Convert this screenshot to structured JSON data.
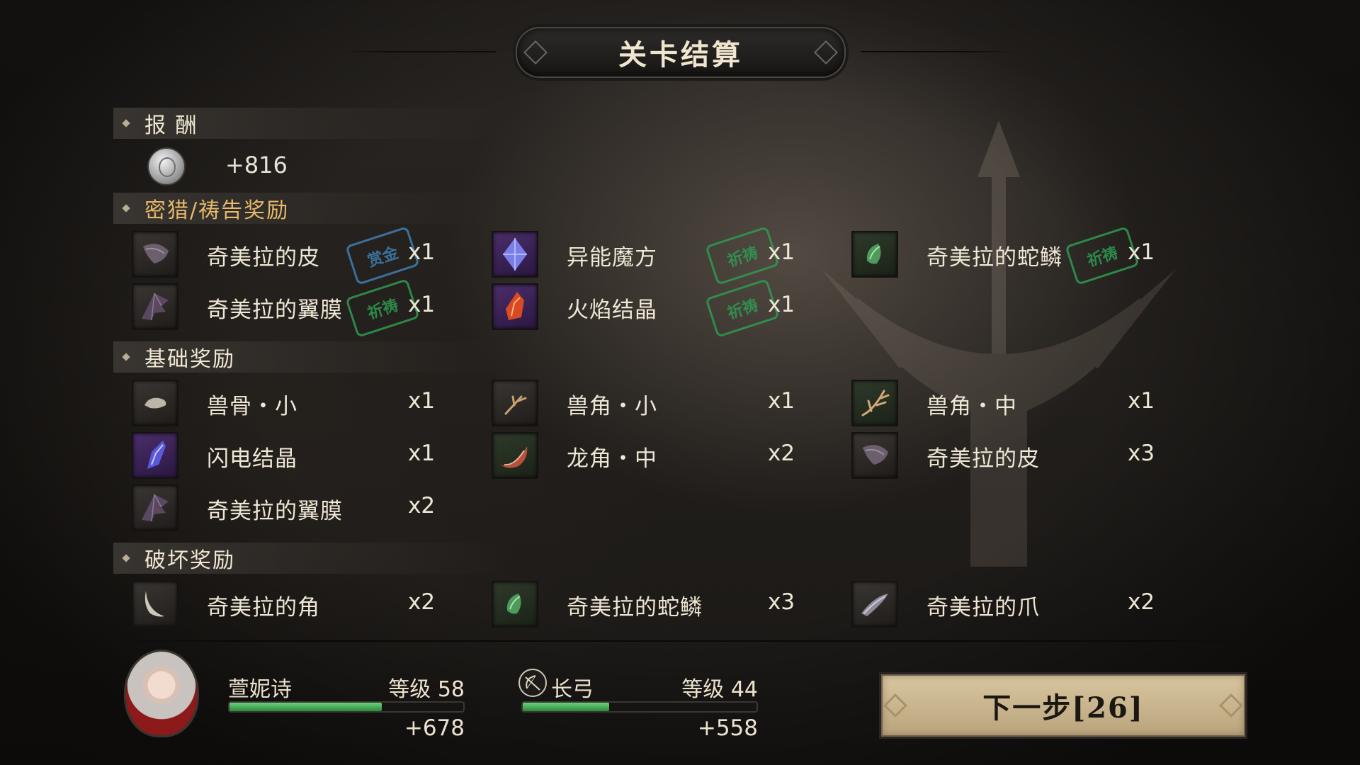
{
  "title": "关卡结算",
  "sections": {
    "reward": "报 酬",
    "hunt": "密猎/祷告奖励",
    "basic": "基础奖励",
    "destroy": "破坏奖励"
  },
  "coin": {
    "icon": "silver-coin-icon",
    "value": "+816"
  },
  "hunt_items": [
    {
      "name": "奇美拉的皮",
      "qty": "x1",
      "stamp": "赏金",
      "icon": "hide-icon"
    },
    {
      "name": "异能魔方",
      "qty": "x1",
      "stamp": "祈祷",
      "icon": "crystal-cube-icon"
    },
    {
      "name": "奇美拉的蛇鳞",
      "qty": "x1",
      "stamp": "祈祷",
      "icon": "scale-icon"
    },
    {
      "name": "奇美拉的翼膜",
      "qty": "x1",
      "stamp": "祈祷",
      "icon": "wing-membrane-icon"
    },
    {
      "name": "火焰结晶",
      "qty": "x1",
      "stamp": "祈祷",
      "icon": "fire-crystal-icon"
    }
  ],
  "basic_items": [
    {
      "name": "兽骨・小",
      "qty": "x1",
      "icon": "bone-icon"
    },
    {
      "name": "兽角・小",
      "qty": "x1",
      "icon": "antler-icon"
    },
    {
      "name": "兽角・中",
      "qty": "x1",
      "icon": "antler-icon"
    },
    {
      "name": "闪电结晶",
      "qty": "x1",
      "icon": "lightning-crystal-icon"
    },
    {
      "name": "龙角・中",
      "qty": "x2",
      "icon": "dragon-horn-icon"
    },
    {
      "name": "奇美拉的皮",
      "qty": "x3",
      "icon": "hide-icon"
    },
    {
      "name": "奇美拉的翼膜",
      "qty": "x2",
      "icon": "wing-membrane-icon"
    }
  ],
  "destroy_items": [
    {
      "name": "奇美拉的角",
      "qty": "x2",
      "icon": "horn-icon"
    },
    {
      "name": "奇美拉的蛇鳞",
      "qty": "x3",
      "icon": "scale-icon"
    },
    {
      "name": "奇美拉的爪",
      "qty": "x2",
      "icon": "claw-icon"
    }
  ],
  "character": {
    "name": "萱妮诗",
    "level_label": "等级 58",
    "exp_gain": "+678",
    "exp_progress": 0.65,
    "bar_color": "#3aa64c"
  },
  "weapon": {
    "name": "长弓",
    "icon": "bow-icon",
    "level_label": "等级 44",
    "exp_gain": "+558",
    "exp_progress": 0.37
  },
  "next_button": "下一步[26]",
  "colors": {
    "accent_gold": "#e7b96c",
    "stamp_green": "#2f9a52",
    "stamp_blue": "#3f7fb3",
    "button_bg": "#d8c6a0"
  }
}
